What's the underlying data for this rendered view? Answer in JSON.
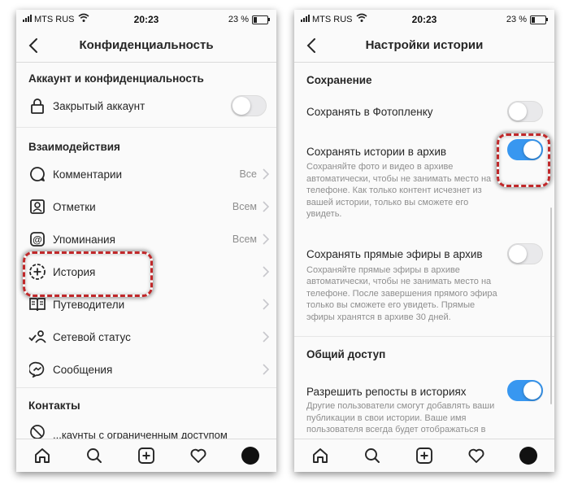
{
  "status_left": {
    "carrier": "MTS RUS",
    "time": "20:23",
    "battery": "23 %"
  },
  "status_right": {
    "carrier": "MTS RUS",
    "time": "20:23",
    "battery": "23 %"
  },
  "privacy": {
    "title": "Конфиденциальность",
    "account_section": "Аккаунт и конфиденциальность",
    "private_account": {
      "label": "Закрытый аккаунт",
      "on": false
    },
    "interactions_section": "Взаимодействия",
    "items": [
      {
        "label": "Комментарии",
        "value": "Все",
        "icon": "comment-icon"
      },
      {
        "label": "Отметки",
        "value": "Всем",
        "icon": "tag-person-icon"
      },
      {
        "label": "Упоминания",
        "value": "Всем",
        "icon": "at-icon"
      },
      {
        "label": "История",
        "value": "",
        "icon": "story-add-icon"
      },
      {
        "label": "Путеводители",
        "value": "",
        "icon": "guide-book-icon"
      },
      {
        "label": "Сетевой статус",
        "value": "",
        "icon": "activity-status-icon"
      },
      {
        "label": "Сообщения",
        "value": "",
        "icon": "messenger-icon"
      }
    ],
    "contacts_section": "Контакты",
    "contacts_first_item": "...каунты с ограниченным доступом"
  },
  "story_settings": {
    "title": "Настройки истории",
    "saving_section": "Сохранение",
    "save_to_camera_roll": {
      "label": "Сохранять в Фотопленку",
      "on": false
    },
    "save_to_archive": {
      "label": "Сохранять истории в архив",
      "on": true,
      "description": [
        "Сохраняйте фото и видео в архиве",
        "автоматически, чтобы не занимать место на",
        "телефоне. Как только контент исчезнет из",
        "вашей истории, только вы сможете его",
        "увидеть."
      ]
    },
    "save_live_to_archive": {
      "label": "Сохранять прямые эфиры в архив",
      "on": false,
      "description": [
        "Сохраняйте прямые эфиры в архиве",
        "автоматически, чтобы не занимать место на",
        "телефоне. После завершения прямого эфира",
        "только вы сможете его увидеть. Прямые",
        "эфиры хранятся в архиве 30 дней."
      ]
    },
    "sharing_section": "Общий доступ",
    "allow_reshares": {
      "label": "Разрешить репосты в историях",
      "on": true,
      "description": [
        "Другие пользователи смогут добавлять ваши",
        "публикации в свои истории. Ваше имя",
        "пользователя всегда будет отображаться в"
      ]
    }
  },
  "tabbar_icons": [
    "home-icon",
    "search-icon",
    "new-post-icon",
    "heart-icon",
    "profile-avatar"
  ],
  "colors": {
    "toggle_on": "#3897f0",
    "highlight": "#c0282a",
    "secondary_text": "#8e8e8e"
  }
}
